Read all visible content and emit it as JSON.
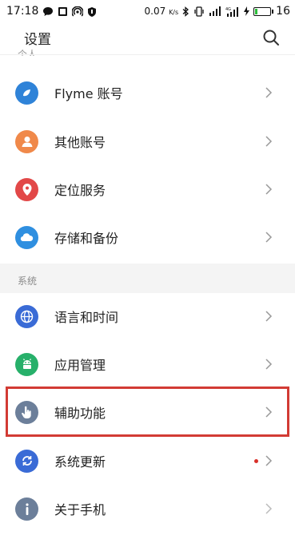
{
  "status_bar": {
    "time": "17:18",
    "speed": "0.07",
    "speed_unit": "K/s",
    "battery": "16",
    "battery_level": 0.16
  },
  "header": {
    "title": "设置"
  },
  "partial_section": {
    "label": "个人"
  },
  "section_personal": {
    "items": [
      {
        "label": "Flyme 账号",
        "icon": "flyme-account-icon",
        "color": "#2f83d8"
      },
      {
        "label": "其他账号",
        "icon": "person-icon",
        "color": "#f0894a"
      },
      {
        "label": "定位服务",
        "icon": "location-pin-icon",
        "color": "#e24848"
      },
      {
        "label": "存储和备份",
        "icon": "cloud-icon",
        "color": "#2f8fe0"
      }
    ]
  },
  "section_system": {
    "label": "系统",
    "items": [
      {
        "label": "语言和时间",
        "icon": "globe-icon",
        "color": "#3a6bd6"
      },
      {
        "label": "应用管理",
        "icon": "android-icon",
        "color": "#27b06a"
      },
      {
        "label": "辅助功能",
        "icon": "hand-pointer-icon",
        "color": "#6c7f9a"
      },
      {
        "label": "系统更新",
        "icon": "refresh-icon",
        "color": "#3a6bd6"
      },
      {
        "label": "关于手机",
        "icon": "info-icon",
        "color": "#6c7f9a"
      }
    ]
  },
  "colors": {
    "highlight": "#d23b34",
    "update_dot": "#d9302a"
  }
}
